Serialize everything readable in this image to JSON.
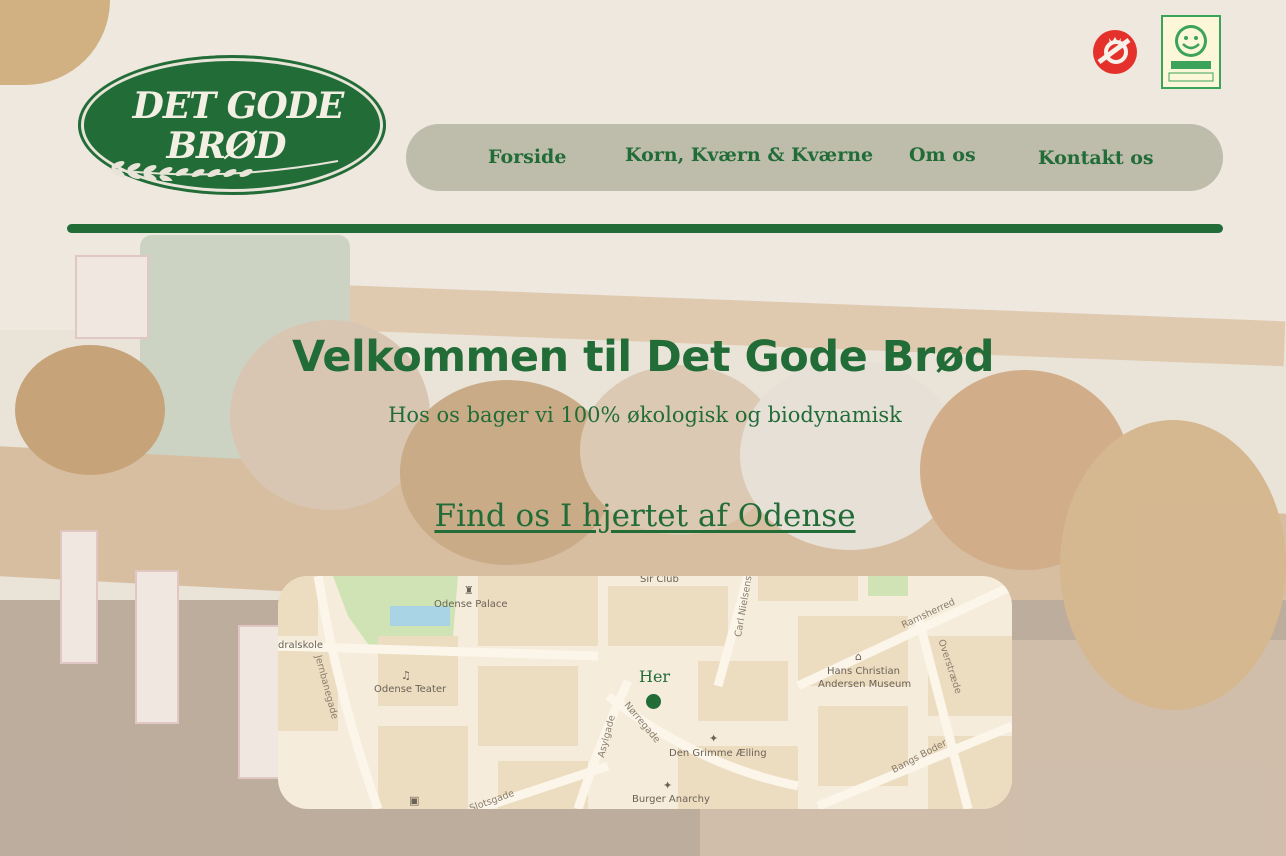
{
  "header": {
    "logo": {
      "line1": "DET GODE",
      "line2": "BRØD"
    },
    "certifications": [
      "organic-label-icon",
      "elite-smiley-icon"
    ]
  },
  "nav": {
    "items": [
      {
        "label": "Forside"
      },
      {
        "label": "Korn, Kværn & Kværne"
      },
      {
        "label": "Om os"
      },
      {
        "label": "Kontakt os"
      }
    ]
  },
  "hero": {
    "title": "Velkommen til Det Gode Brød",
    "subtitle": "Hos os bager vi 100% økologisk og biodynamisk",
    "link": "Find os I hjertet af Odense"
  },
  "map": {
    "marker_label": "Her",
    "places": {
      "sir_club": "Sir Club",
      "odense_palace": "Odense Palace",
      "dralskole": "dralskole",
      "odense_teater": "Odense Teater",
      "hca_museum_1": "Hans Christian",
      "hca_museum_2": "Andersen Museum",
      "den_grimme": "Den Grimme Ælling",
      "burger": "Burger Anarchy"
    },
    "streets": {
      "jernbanegade": "Jernbanegade",
      "carl_nielsens": "Carl Nielsens",
      "ramsherred": "Ramsherred",
      "overstraede": "Overstræde",
      "asylgade": "Asylgade",
      "noerregade": "Nørregade",
      "bangs_boder": "Bangs Boder",
      "slotsgade": "Slotsgade"
    }
  },
  "colors": {
    "brand_green": "#226c38",
    "nav_background": "#bab8a6",
    "map_background": "#f5ecdb"
  }
}
